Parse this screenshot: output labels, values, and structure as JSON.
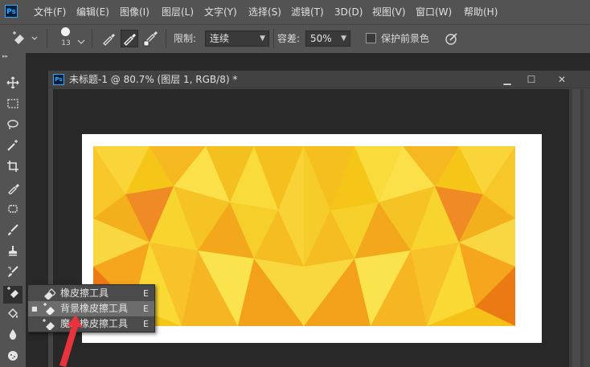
{
  "app": {
    "logo": "Ps",
    "menu": [
      "文件(F)",
      "编辑(E)",
      "图像(I)",
      "图层(L)",
      "文字(Y)",
      "选择(S)",
      "滤镜(T)",
      "3D(D)",
      "视图(V)",
      "窗口(W)",
      "帮助(H)"
    ]
  },
  "options": {
    "brush_size": "13",
    "limit_label": "限制:",
    "limit_value": "连续",
    "tolerance_label": "容差:",
    "tolerance_value": "50%",
    "protect_fg_label": "保护前景色",
    "protect_fg_checked": false
  },
  "document": {
    "logo": "Ps",
    "title": "未标题-1 @ 80.7% (图层 1, RGB/8) *"
  },
  "flyout": {
    "items": [
      {
        "label": "橡皮擦工具",
        "key": "E",
        "selected": false,
        "icon": "eraser-icon"
      },
      {
        "label": "背景橡皮擦工具",
        "key": "E",
        "selected": true,
        "icon": "background-eraser-icon"
      },
      {
        "label": "魔术橡皮擦工具",
        "key": "E",
        "selected": false,
        "icon": "magic-eraser-icon"
      }
    ]
  },
  "colors": {
    "accent": "#31a8ff",
    "annotation_arrow": "#e8323c",
    "art_base": "#f5c518"
  }
}
